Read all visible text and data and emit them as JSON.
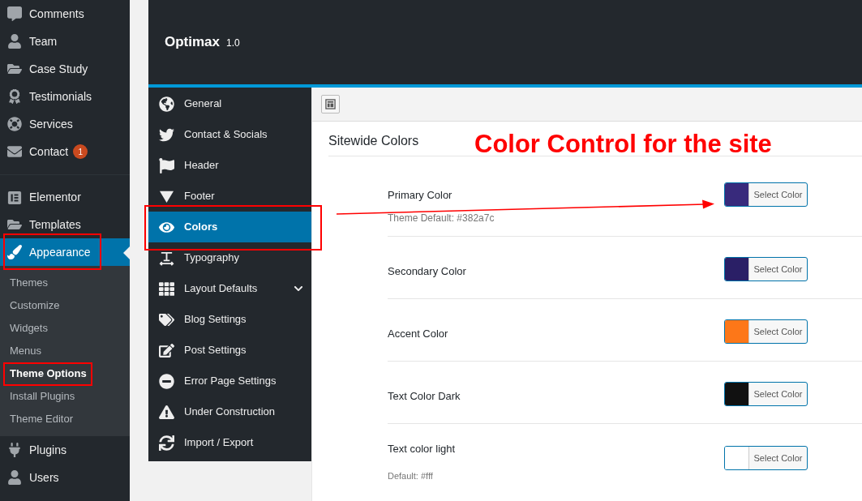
{
  "admin_menu": {
    "items": [
      {
        "label": "Comments",
        "selected": false,
        "annotated": false
      },
      {
        "label": "Team",
        "selected": false,
        "annotated": false
      },
      {
        "label": "Case Study",
        "selected": false,
        "annotated": false
      },
      {
        "label": "Testimonials",
        "selected": false,
        "annotated": false
      },
      {
        "label": "Services",
        "selected": false,
        "annotated": false
      },
      {
        "label": "Contact",
        "selected": false,
        "annotated": false,
        "badge": "1"
      },
      {
        "label": "Elementor",
        "selected": false,
        "annotated": false,
        "separator_before": true
      },
      {
        "label": "Templates",
        "selected": false,
        "annotated": false
      },
      {
        "label": "Appearance",
        "selected": true,
        "annotated": true,
        "children": [
          {
            "label": "Themes",
            "selected": false,
            "annotated": false
          },
          {
            "label": "Customize",
            "selected": false,
            "annotated": false
          },
          {
            "label": "Widgets",
            "selected": false,
            "annotated": false
          },
          {
            "label": "Menus",
            "selected": false,
            "annotated": false
          },
          {
            "label": "Theme Options",
            "selected": true,
            "annotated": true
          },
          {
            "label": "Install Plugins",
            "selected": false,
            "annotated": false
          },
          {
            "label": "Theme Editor",
            "selected": false,
            "annotated": false
          }
        ]
      },
      {
        "label": "Plugins",
        "selected": false,
        "annotated": false
      },
      {
        "label": "Users",
        "selected": false,
        "annotated": false
      }
    ]
  },
  "options_panel": {
    "title": "Optimax",
    "version": "1.0",
    "nav": [
      {
        "label": "General",
        "selected": false,
        "annotated": false
      },
      {
        "label": "Contact & Socials",
        "selected": false,
        "annotated": false
      },
      {
        "label": "Header",
        "selected": false,
        "annotated": false
      },
      {
        "label": "Footer",
        "selected": false,
        "annotated": false
      },
      {
        "label": "Colors",
        "selected": true,
        "annotated": true
      },
      {
        "label": "Typography",
        "selected": false,
        "annotated": false
      },
      {
        "label": "Layout Defaults",
        "selected": false,
        "annotated": false,
        "expandable": true
      },
      {
        "label": "Blog Settings",
        "selected": false,
        "annotated": false
      },
      {
        "label": "Post Settings",
        "selected": false,
        "annotated": false
      },
      {
        "label": "Error Page Settings",
        "selected": false,
        "annotated": false
      },
      {
        "label": "Under Construction",
        "selected": false,
        "annotated": false
      },
      {
        "label": "Import / Export",
        "selected": false,
        "annotated": false
      }
    ],
    "section_title": "Sitewide Colors",
    "fields": [
      {
        "label": "Primary Color",
        "description": "Theme Default: #382a7c",
        "color": "#382a7c",
        "button": "Select Color"
      },
      {
        "label": "Secondary Color",
        "color": "#2a1f66",
        "button": "Select Color"
      },
      {
        "label": "Accent Color",
        "color": "#fd7718",
        "button": "Select Color"
      },
      {
        "label": "Text Color Dark",
        "color": "#111111",
        "button": "Select Color"
      },
      {
        "label": "Text color light",
        "description": "Default: #fff",
        "color": "#ffffff",
        "button": "Select Color"
      }
    ]
  },
  "annotation": {
    "text": "Color Control for the site"
  }
}
